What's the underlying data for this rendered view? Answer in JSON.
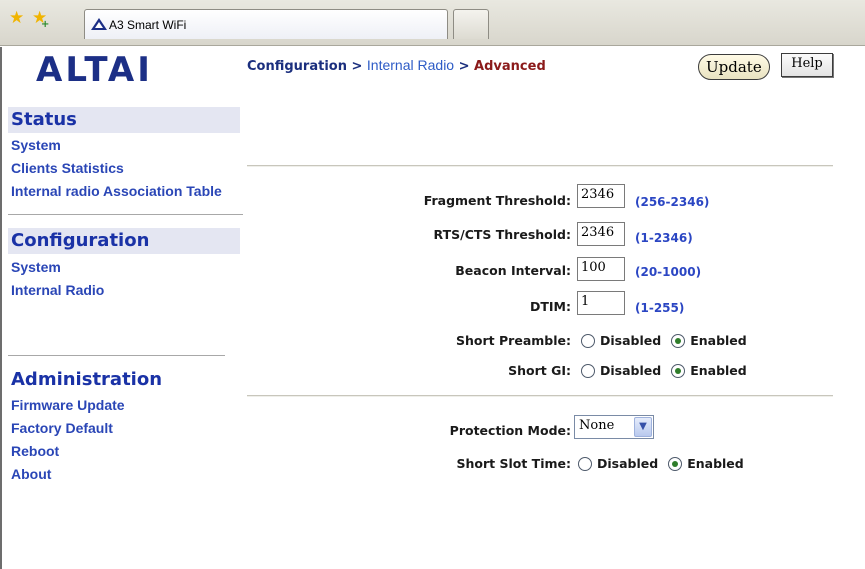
{
  "browser": {
    "tab_title": "A3 Smart WiFi"
  },
  "logo": {
    "text": "ALTAI",
    "color": "#1c2f86"
  },
  "sidebar": {
    "status": {
      "heading": "Status",
      "items": [
        "System",
        "Clients Statistics",
        "Internal radio Association Table"
      ]
    },
    "configuration": {
      "heading": "Configuration",
      "items": [
        "System",
        "Internal Radio"
      ]
    },
    "administration": {
      "heading": "Administration",
      "items": [
        "Firmware Update",
        "Factory Default",
        "Reboot",
        "About"
      ]
    }
  },
  "breadcrumb": {
    "part1": "Configuration",
    "sep1": " > ",
    "part2": "Internal Radio",
    "sep2": " > ",
    "part3": "Advanced"
  },
  "buttons": {
    "update": "Update",
    "help": "Help"
  },
  "form": {
    "fragment_threshold": {
      "label": "Fragment Threshold:",
      "value": "2346",
      "range": "(256-2346)"
    },
    "rts_cts_threshold": {
      "label": "RTS/CTS Threshold:",
      "value": "2346",
      "range": "(1-2346)"
    },
    "beacon_interval": {
      "label": "Beacon Interval:",
      "value": "100",
      "range": "(20-1000)"
    },
    "dtim": {
      "label": "DTIM:",
      "value": "1",
      "range": "(1-255)"
    },
    "short_preamble": {
      "label": "Short Preamble:",
      "options": [
        "Disabled",
        "Enabled"
      ],
      "selected": "Enabled"
    },
    "short_gi": {
      "label": "Short GI:",
      "options": [
        "Disabled",
        "Enabled"
      ],
      "selected": "Enabled"
    },
    "protection_mode": {
      "label": "Protection Mode:",
      "value": "None"
    },
    "short_slot_time": {
      "label": "Short Slot Time:",
      "options": [
        "Disabled",
        "Enabled"
      ],
      "selected": "Enabled"
    }
  },
  "icons": {
    "bookmark": "star-icon",
    "add_bookmark": "star-plus-icon",
    "site": "altai-logo-icon",
    "select_arrow": "chevron-down-icon"
  },
  "colors": {
    "nav_heading": "#1a32a6",
    "nav_link": "#2a46b6",
    "range_text": "#2b46c3",
    "breadcrumb_current": "#8b1a1a",
    "radio_selected": "#2f7d2a"
  }
}
